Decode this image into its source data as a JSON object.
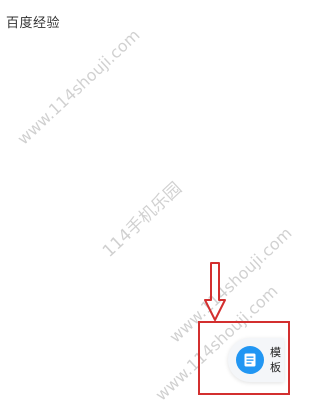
{
  "doc": {
    "title": "百度经验"
  },
  "watermarks": {
    "w1": "www.114shouji.com",
    "w2": "114手机乐园",
    "w3": "www.114shouji.com",
    "w4": "www.114shouji.com"
  },
  "template_button": {
    "label": "模板",
    "icon": "document-icon"
  },
  "colors": {
    "accent": "#2196f3",
    "annotation": "#d32f2f"
  }
}
